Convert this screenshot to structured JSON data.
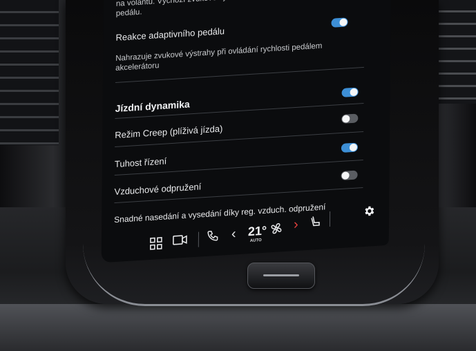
{
  "settings": {
    "top_partial": {
      "text_line1": "na volantu. Výchozí zvukové výstrahy lze nahradit",
      "text_line2": "pedálu.",
      "toggle": "on"
    },
    "adaptive_pedal": {
      "title": "Reakce adaptivního pedálu",
      "description_line1": "Nahrazuje zvukové výstrahy při ovládání rychlosti pedálem",
      "description_line2": "akcelerátoru"
    },
    "section_heading": "Jízdní dynamika",
    "section_toggle": "on",
    "creep": {
      "label": "Režim Creep (plíživá jízda)",
      "toggle": "off"
    },
    "steering": {
      "label": "Tuhost řízení",
      "toggle": "on"
    },
    "air_suspension": {
      "label": "Vzduchové odpružení",
      "toggle": "off"
    },
    "easy_entry": {
      "label": "Snadné nasedání a vysedání díky reg. vzduch. odpružení"
    }
  },
  "bottom_bar": {
    "temperature": "21°",
    "temperature_mode": "AUTO",
    "icons": [
      "app-grid-icon",
      "camera-icon",
      "phone-icon",
      "chevron-left-icon",
      "fan-icon",
      "chevron-right-icon",
      "heated-seat-icon"
    ]
  },
  "colors": {
    "toggle_on": "#3d8fd6",
    "toggle_off": "#5a5d62",
    "next_arrow": "#e2403d"
  }
}
